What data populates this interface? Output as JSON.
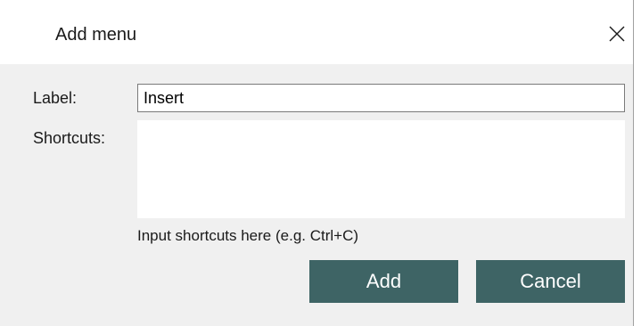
{
  "dialog": {
    "title": "Add menu",
    "close_icon": "close-icon"
  },
  "form": {
    "label_caption": "Label:",
    "label_value": "Insert",
    "shortcuts_caption": "Shortcuts:",
    "shortcuts_value": "",
    "hint": "Input shortcuts here (e.g. Ctrl+C)"
  },
  "buttons": {
    "add": "Add",
    "cancel": "Cancel"
  },
  "colors": {
    "button_bg": "#3e6465",
    "button_text": "#ffffff",
    "dialog_bg": "#f0f0f0",
    "titlebar_bg": "#ffffff"
  }
}
